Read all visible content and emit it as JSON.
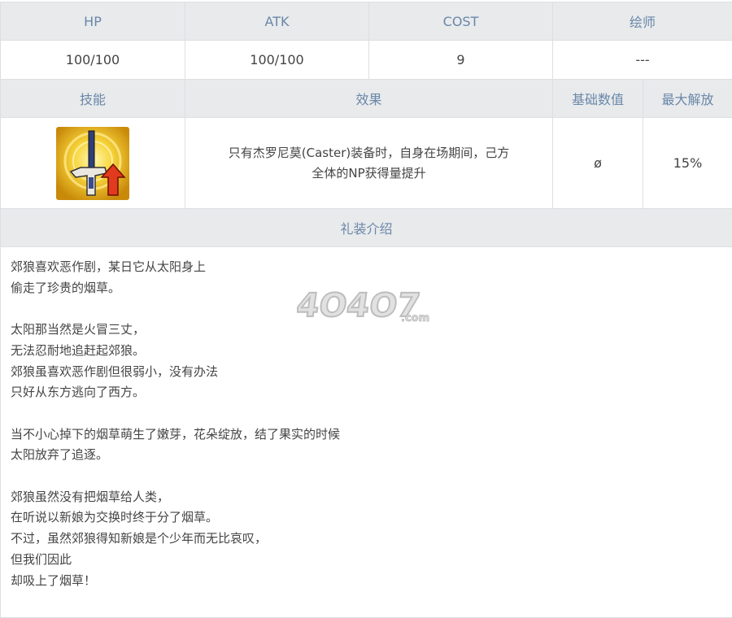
{
  "stats_header": {
    "hp": "HP",
    "atk": "ATK",
    "cost": "COST",
    "illustrator": "绘师"
  },
  "stats_values": {
    "hp": "100/100",
    "atk": "100/100",
    "cost": "9",
    "illustrator": "---"
  },
  "skill_header": {
    "skill": "技能",
    "effect": "效果",
    "base_value": "基础数值",
    "max_limit_break": "最大解放"
  },
  "skill_row": {
    "icon": "np-gain-up-sword-icon",
    "effect_line1": "只有杰罗尼莫(Caster)装备时，自身在场期间，己方",
    "effect_line2": "全体的NP获得量提升",
    "base_value": "ø",
    "max_value": "15%"
  },
  "description_header": "礼装介绍",
  "description_paragraphs": [
    "郊狼喜欢恶作剧，某日它从太阳身上\n偷走了珍贵的烟草。",
    "太阳那当然是火冒三丈，\n无法忍耐地追赶起郊狼。\n郊狼虽喜欢恶作剧但很弱小，没有办法\n只好从东方逃向了西方。",
    "当不小心掉下的烟草萌生了嫩芽，花朵绽放，结了果实的时候\n太阳放弃了追逐。",
    "郊狼虽然没有把烟草给人类，\n在听说以新娘为交换时终于分了烟草。\n不过，虽然郊狼得知新娘是个少年而无比哀叹，\n但我们因此\n却吸上了烟草！"
  ],
  "watermark": {
    "text": "4O4O7",
    "suffix": ".com"
  }
}
